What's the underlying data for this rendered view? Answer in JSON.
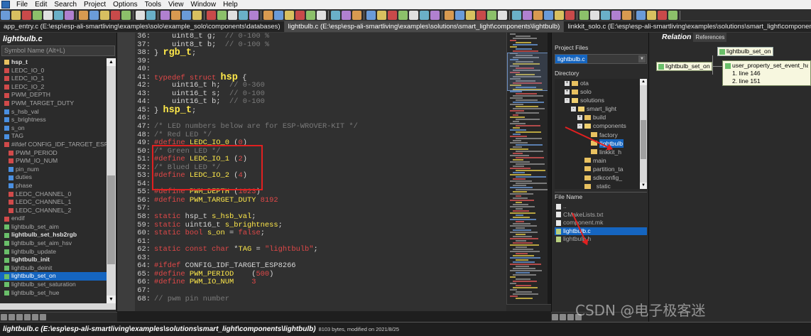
{
  "menubar": {
    "items": [
      "File",
      "Edit",
      "Search",
      "Project",
      "Options",
      "Tools",
      "View",
      "Window",
      "Help"
    ]
  },
  "tabs": [
    {
      "label": "app_entry.c (E:\\esp\\esp-ali-smartliving\\examples\\solo\\example_solo\\components\\databases)",
      "active": false
    },
    {
      "label": "lightbulb.c (E:\\esp\\esp-ali-smartliving\\examples\\solutions\\smart_light\\components\\lightbulb)",
      "active": true
    },
    {
      "label": "linkkit_solo.c (E:\\esp\\esp-ali-smartliving\\examples\\solutions\\smart_light\\components\\linkkit_handle)",
      "active": false
    }
  ],
  "symbol_panel": {
    "title": "lightbulb.c",
    "search_placeholder": "Symbol Name (Alt+L)",
    "items": [
      {
        "label": "hsp_t",
        "icon": "struct-icon",
        "color": "#e8c160",
        "bold": true
      },
      {
        "label": "LEDC_IO_0",
        "icon": "define-icon",
        "color": "#d04a4a"
      },
      {
        "label": "LEDC_IO_1",
        "icon": "define-icon",
        "color": "#d04a4a"
      },
      {
        "label": "LEDC_IO_2",
        "icon": "define-icon",
        "color": "#d04a4a"
      },
      {
        "label": "PWM_DEPTH",
        "icon": "define-icon",
        "color": "#d04a4a"
      },
      {
        "label": "PWM_TARGET_DUTY",
        "icon": "define-icon",
        "color": "#d04a4a"
      },
      {
        "label": "s_hsb_val",
        "icon": "variable-icon",
        "color": "#4a8fe0"
      },
      {
        "label": "s_brightness",
        "icon": "variable-icon",
        "color": "#4a8fe0"
      },
      {
        "label": "s_on",
        "icon": "variable-icon",
        "color": "#4a8fe0"
      },
      {
        "label": "TAG",
        "icon": "variable-icon",
        "color": "#4a8fe0"
      },
      {
        "label": "#ifdef CONFIG_IDF_TARGET_ESP8266",
        "icon": "ifdef-icon",
        "color": "#d04a4a"
      },
      {
        "label": "PWM_PERIOD",
        "icon": "define-icon",
        "color": "#d04a4a"
      },
      {
        "label": "PWM_IO_NUM",
        "icon": "define-icon",
        "color": "#d04a4a"
      },
      {
        "label": "pin_num",
        "icon": "variable-icon",
        "color": "#4a8fe0"
      },
      {
        "label": "duties",
        "icon": "variable-icon",
        "color": "#4a8fe0"
      },
      {
        "label": "phase",
        "icon": "variable-icon",
        "color": "#4a8fe0"
      },
      {
        "label": "LEDC_CHANNEL_0",
        "icon": "define-icon",
        "color": "#d04a4a"
      },
      {
        "label": "LEDC_CHANNEL_1",
        "icon": "define-icon",
        "color": "#d04a4a"
      },
      {
        "label": "LEDC_CHANNEL_2",
        "icon": "define-icon",
        "color": "#d04a4a"
      },
      {
        "label": "endif",
        "icon": "ifdef-icon",
        "color": "#d04a4a"
      },
      {
        "label": "lightbulb_set_aim",
        "icon": "function-icon",
        "color": "#6abf6a"
      },
      {
        "label": "lightbulb_set_hsb2rgb",
        "icon": "function-icon",
        "color": "#6abf6a",
        "bold": true
      },
      {
        "label": "lightbulb_set_aim_hsv",
        "icon": "function-icon",
        "color": "#6abf6a"
      },
      {
        "label": "lightbulb_update",
        "icon": "function-icon",
        "color": "#6abf6a"
      },
      {
        "label": "lightbulb_init",
        "icon": "function-icon",
        "color": "#6abf6a",
        "bold": true
      },
      {
        "label": "lightbulb_deinit",
        "icon": "function-icon",
        "color": "#6abf6a"
      },
      {
        "label": "lightbulb_set_on",
        "icon": "function-icon",
        "color": "#6abf6a",
        "selected": true
      },
      {
        "label": "lightbulb_set_saturation",
        "icon": "function-icon",
        "color": "#6abf6a"
      },
      {
        "label": "lightbulb_set_hue",
        "icon": "function-icon",
        "color": "#6abf6a"
      }
    ]
  },
  "editor": {
    "lines": [
      {
        "n": "36:",
        "parts": [
          [
            "tx",
            "    "
          ],
          [
            "ty",
            "uint8_t "
          ],
          [
            "tx",
            "g;  "
          ],
          [
            "cm",
            "// 0-100 %"
          ]
        ]
      },
      {
        "n": "37:",
        "parts": [
          [
            "tx",
            "    "
          ],
          [
            "ty",
            "uint8_t "
          ],
          [
            "tx",
            "b;  "
          ],
          [
            "cm",
            "// 0-100 %"
          ]
        ]
      },
      {
        "n": "38:",
        "parts": [
          [
            "tx",
            "} "
          ],
          [
            "big",
            "rgb_t"
          ],
          [
            "tx",
            ";"
          ]
        ]
      },
      {
        "n": "39:",
        "parts": []
      },
      {
        "n": "40:",
        "parts": []
      },
      {
        "n": "41:",
        "parts": [
          [
            "kw",
            "typedef struct "
          ],
          [
            "big",
            "hsp"
          ],
          [
            "tx",
            " {"
          ]
        ]
      },
      {
        "n": "42:",
        "parts": [
          [
            "tx",
            "    "
          ],
          [
            "ty",
            "uint16_t "
          ],
          [
            "tx",
            "h;  "
          ],
          [
            "cm",
            "// 0-360"
          ]
        ]
      },
      {
        "n": "43:",
        "parts": [
          [
            "tx",
            "    "
          ],
          [
            "ty",
            "uint16_t "
          ],
          [
            "tx",
            "s;  "
          ],
          [
            "cm",
            "// 0-100"
          ]
        ]
      },
      {
        "n": "44:",
        "parts": [
          [
            "tx",
            "    "
          ],
          [
            "ty",
            "uint16_t "
          ],
          [
            "tx",
            "b;  "
          ],
          [
            "cm",
            "// 0-100"
          ]
        ]
      },
      {
        "n": "45:",
        "parts": [
          [
            "tx",
            "} "
          ],
          [
            "big",
            "hsp_t"
          ],
          [
            "tx",
            ";"
          ]
        ]
      },
      {
        "n": "46:",
        "parts": []
      },
      {
        "n": "47:",
        "parts": [
          [
            "cm",
            "/* LED numbers below are for ESP-WROVER-KIT */"
          ]
        ]
      },
      {
        "n": "48:",
        "parts": [
          [
            "cm",
            "/* Red LED */"
          ]
        ]
      },
      {
        "n": "49:",
        "parts": [
          [
            "kw",
            "#define "
          ],
          [
            "id",
            "LEDC_IO_0 "
          ],
          [
            "tx",
            "("
          ],
          [
            "num",
            "0"
          ],
          [
            "tx",
            ")"
          ]
        ]
      },
      {
        "n": "50:",
        "parts": [
          [
            "cm",
            "/* Green LED */"
          ]
        ]
      },
      {
        "n": "51:",
        "parts": [
          [
            "kw",
            "#define "
          ],
          [
            "id",
            "LEDC_IO_1 "
          ],
          [
            "tx",
            "("
          ],
          [
            "num",
            "2"
          ],
          [
            "tx",
            ")"
          ]
        ]
      },
      {
        "n": "52:",
        "parts": [
          [
            "cm",
            "/* Blued LED */"
          ]
        ]
      },
      {
        "n": "53:",
        "parts": [
          [
            "kw",
            "#define "
          ],
          [
            "id",
            "LEDC_IO_2 "
          ],
          [
            "tx",
            "("
          ],
          [
            "num",
            "4"
          ],
          [
            "tx",
            ")"
          ]
        ]
      },
      {
        "n": "54:",
        "parts": []
      },
      {
        "n": "55:",
        "parts": [
          [
            "kw",
            "#define "
          ],
          [
            "id",
            "PWM_DEPTH "
          ],
          [
            "tx",
            "("
          ],
          [
            "num",
            "1023"
          ],
          [
            "tx",
            ")"
          ]
        ]
      },
      {
        "n": "56:",
        "parts": [
          [
            "kw",
            "#define "
          ],
          [
            "id",
            "PWM_TARGET_DUTY "
          ],
          [
            "num",
            "8192"
          ]
        ]
      },
      {
        "n": "57:",
        "parts": []
      },
      {
        "n": "58:",
        "parts": [
          [
            "kw",
            "static "
          ],
          [
            "ty",
            "hsp_t "
          ],
          [
            "id",
            "s_hsb_val"
          ],
          [
            "tx",
            ";"
          ]
        ]
      },
      {
        "n": "59:",
        "parts": [
          [
            "kw",
            "static "
          ],
          [
            "ty",
            "uint16_t "
          ],
          [
            "id",
            "s_brightness"
          ],
          [
            "tx",
            ";"
          ]
        ]
      },
      {
        "n": "60:",
        "parts": [
          [
            "kw",
            "static bool "
          ],
          [
            "id",
            "s_on "
          ],
          [
            "tx",
            "= "
          ],
          [
            "kw",
            "false"
          ],
          [
            "tx",
            ";"
          ]
        ]
      },
      {
        "n": "61:",
        "parts": []
      },
      {
        "n": "62:",
        "parts": [
          [
            "kw",
            "static const char "
          ],
          [
            "tx",
            "*"
          ],
          [
            "id",
            "TAG "
          ],
          [
            "tx",
            "= "
          ],
          [
            "str",
            "\"lightbulb\""
          ],
          [
            "tx",
            ";"
          ]
        ]
      },
      {
        "n": "63:",
        "parts": []
      },
      {
        "n": "64:",
        "parts": [
          [
            "kw",
            "#ifdef "
          ],
          [
            "tx",
            "CONFIG_IDF_TARGET_ESP8266"
          ]
        ]
      },
      {
        "n": "65:",
        "parts": [
          [
            "kw",
            "#define "
          ],
          [
            "id",
            "PWM_PERIOD    "
          ],
          [
            "tx",
            "("
          ],
          [
            "num",
            "500"
          ],
          [
            "tx",
            ")"
          ]
        ]
      },
      {
        "n": "66:",
        "parts": [
          [
            "kw",
            "#define "
          ],
          [
            "id",
            "PWM_IO_NUM    "
          ],
          [
            "num",
            "3"
          ]
        ]
      },
      {
        "n": "67:",
        "parts": []
      },
      {
        "n": "68:",
        "parts": [
          [
            "cm",
            "// pwm pin number"
          ]
        ]
      }
    ]
  },
  "project_panel": {
    "header": "Project Files",
    "project_select": "lightbulb.c",
    "directory_header": "Directory",
    "dirs": [
      {
        "label": "ota",
        "indent": 2,
        "pm": "+"
      },
      {
        "label": "solo",
        "indent": 2,
        "pm": "+"
      },
      {
        "label": "solutions",
        "indent": 2,
        "pm": "-"
      },
      {
        "label": "smart_light",
        "indent": 3,
        "pm": "-"
      },
      {
        "label": "build",
        "indent": 4,
        "pm": "+"
      },
      {
        "label": "components",
        "indent": 4,
        "pm": "-"
      },
      {
        "label": "factory",
        "indent": 5
      },
      {
        "label": "lightbulb",
        "indent": 5,
        "selected": true
      },
      {
        "label": "linkkit_h",
        "indent": 5
      },
      {
        "label": "main",
        "indent": 4
      },
      {
        "label": "partition_ta",
        "indent": 4
      },
      {
        "label": "sdkconfig_",
        "indent": 4
      },
      {
        "label": "_static",
        "indent": 4
      }
    ],
    "files_header": "File Name",
    "files": [
      {
        "label": "..",
        "kind": "up"
      },
      {
        "label": "CMakeLists.txt",
        "kind": "txt"
      },
      {
        "label": "component.mk",
        "kind": "txt"
      },
      {
        "label": "lightbulb.c",
        "kind": "c",
        "selected": true
      },
      {
        "label": "lightbulb.h",
        "kind": "c"
      }
    ]
  },
  "relation_panel": {
    "title": "Relation",
    "tab": "References",
    "node_top": "lightbulb_set_on",
    "node_left": "lightbulb_set_on",
    "ref_title": "user_property_set_event_handl",
    "refs": [
      "1. line 146",
      "2. line 151"
    ]
  },
  "statusbar": {
    "path": "lightbulb.c (E:\\esp\\esp-ali-smartliving\\examples\\solutions\\smart_light\\components\\lightbulb)",
    "info": "8103 bytes, modified on 2021/8/25"
  },
  "watermark": "CSDN @电子极客迷"
}
